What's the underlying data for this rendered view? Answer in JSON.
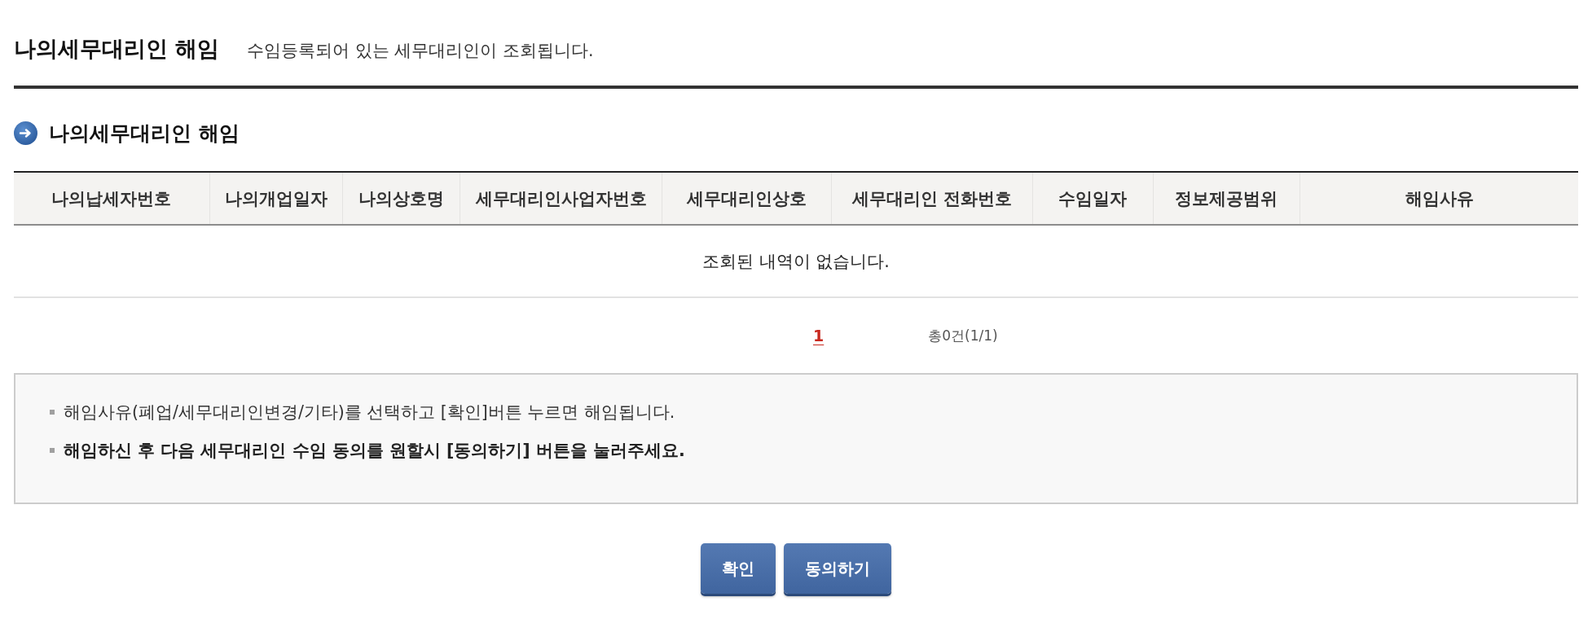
{
  "page": {
    "title": "나의세무대리인 해임",
    "subtitle": "수임등록되어 있는 세무대리인이 조회됩니다."
  },
  "section": {
    "title": "나의세무대리인 해임"
  },
  "table": {
    "columns": [
      "나의납세자번호",
      "나의개업일자",
      "나의상호명",
      "세무대리인사업자번호",
      "세무대리인상호",
      "세무대리인 전화번호",
      "수임일자",
      "정보제공범위",
      "해임사유"
    ],
    "empty_message": "조회된 내역이 없습니다."
  },
  "pagination": {
    "pages": [
      {
        "label": "1",
        "selected": true
      }
    ],
    "summary": "총0건(1/1)"
  },
  "notice": {
    "items": [
      {
        "text": "해임사유(폐업/세무대리인변경/기타)를 선택하고 [확인]버튼 누르면 해임됩니다.",
        "emphasized": false
      },
      {
        "text": "해임하신 후 다음 세무대리인 수임 동의를 원할시 [동의하기] 버튼을 눌러주세요.",
        "emphasized": true
      }
    ]
  },
  "buttons": [
    {
      "label": "확인"
    },
    {
      "label": "동의하기"
    }
  ]
}
